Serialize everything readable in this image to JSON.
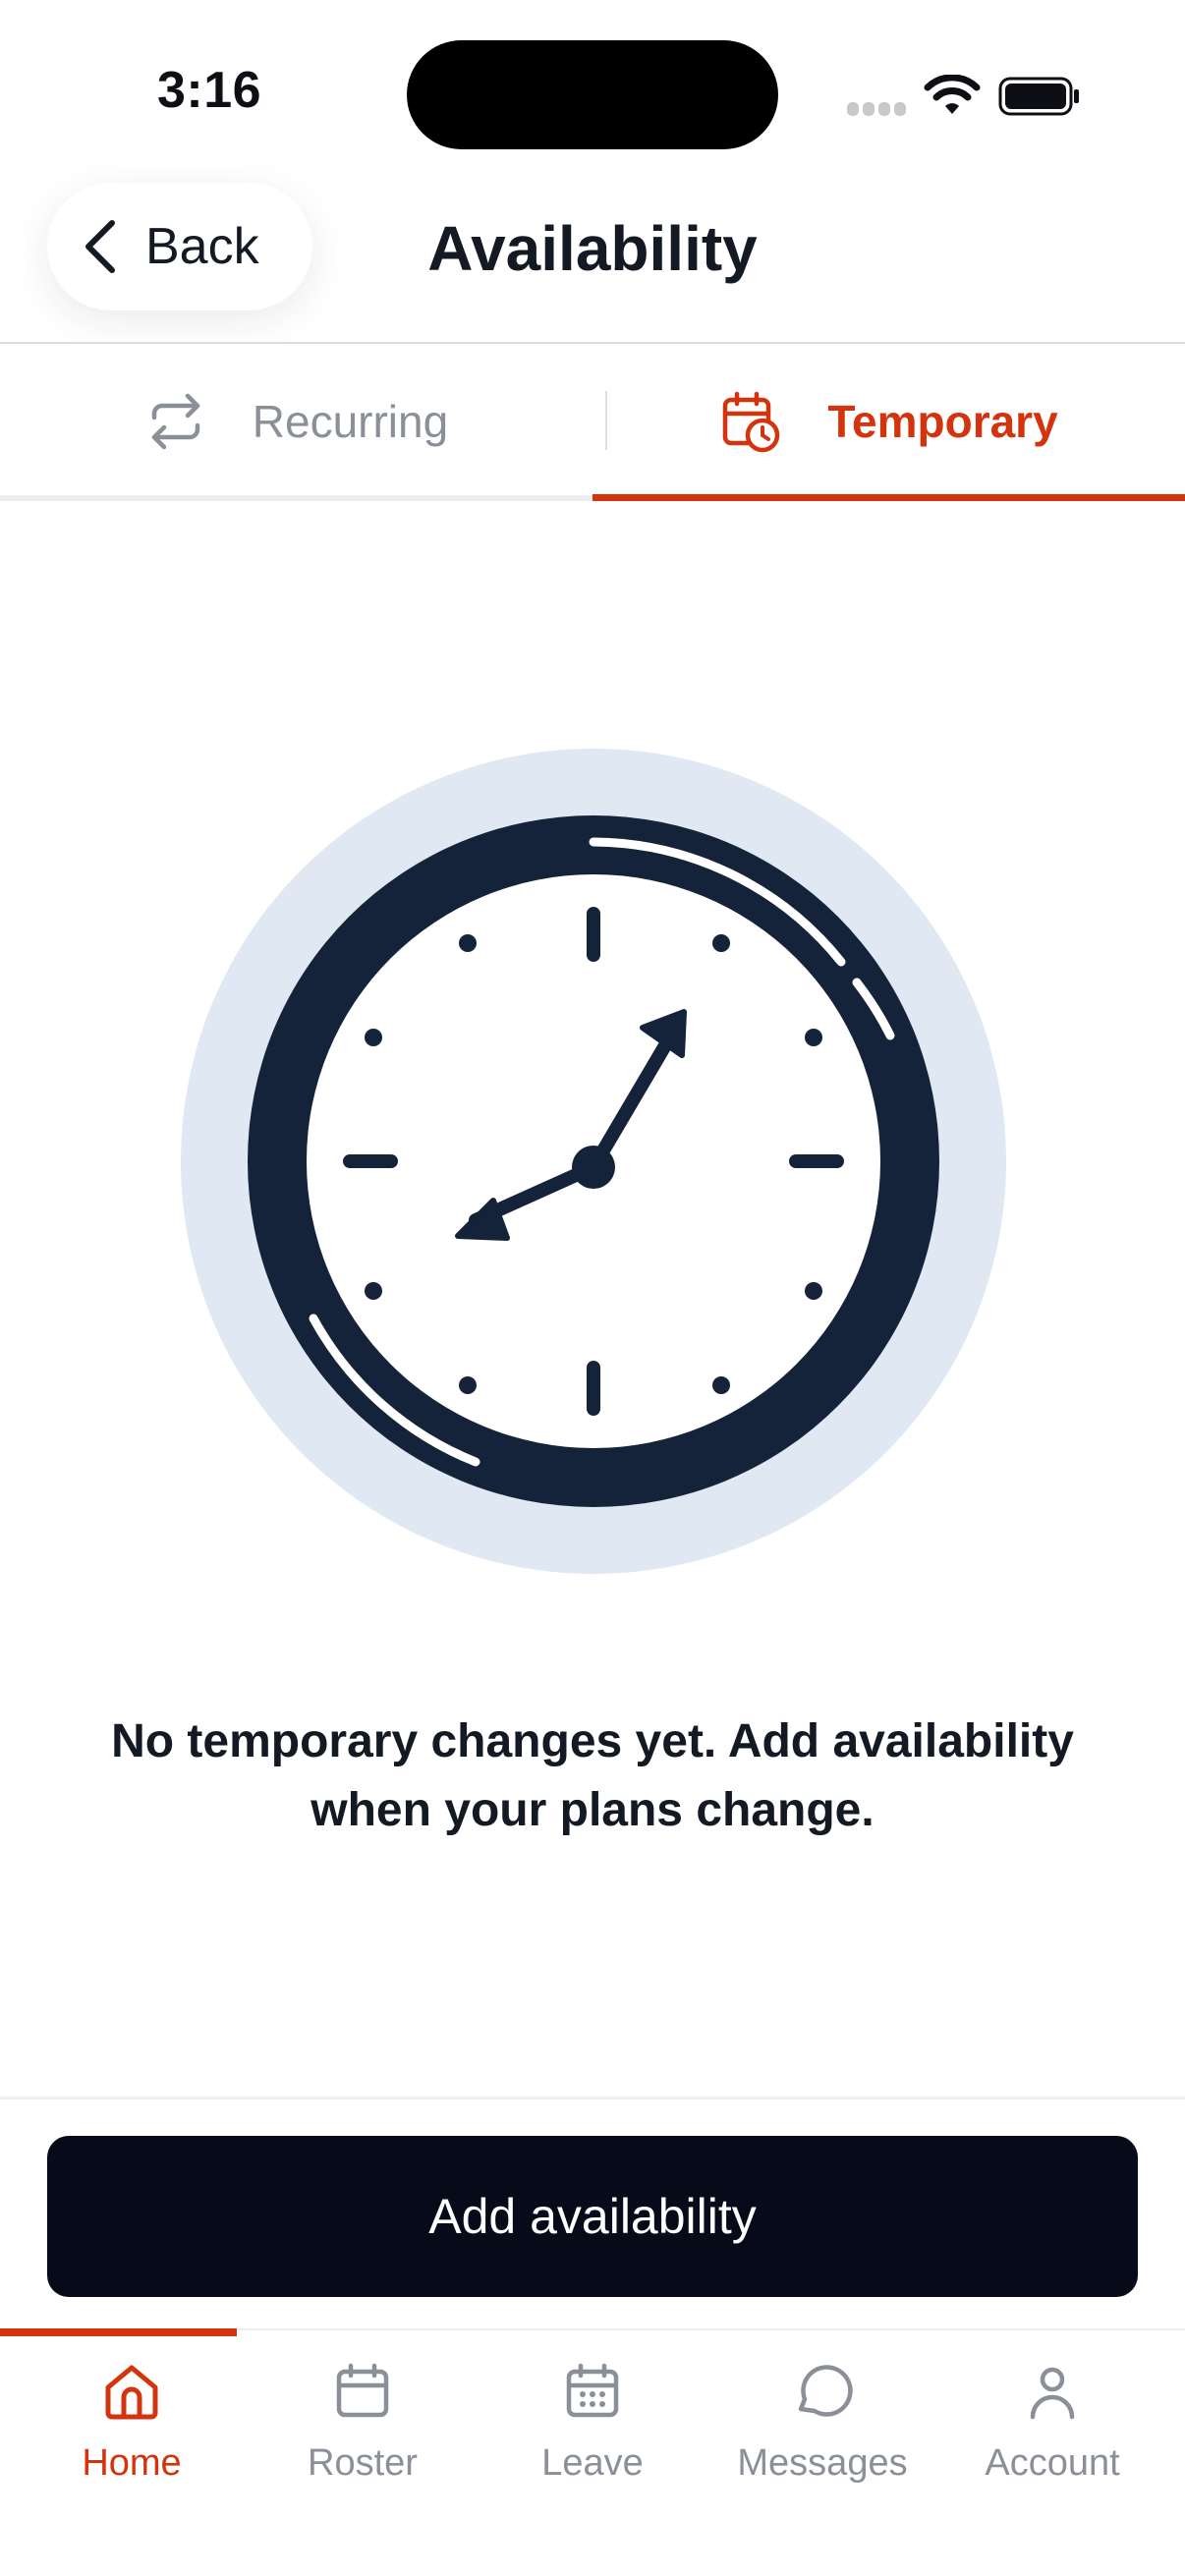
{
  "status_bar": {
    "time": "3:16"
  },
  "header": {
    "back_label": "Back",
    "title": "Availability"
  },
  "tabs": [
    {
      "label": "Recurring",
      "icon": "repeat-icon",
      "active": false
    },
    {
      "label": "Temporary",
      "icon": "calendar-clock-icon",
      "active": true
    }
  ],
  "empty_state": {
    "illustration": "clock-icon",
    "message": "No temporary changes yet. Add availability when your plans change."
  },
  "actions": {
    "add_label": "Add availability"
  },
  "tab_bar": {
    "items": [
      {
        "label": "Home",
        "icon": "home-icon",
        "active": true
      },
      {
        "label": "Roster",
        "icon": "calendar-icon",
        "active": false
      },
      {
        "label": "Leave",
        "icon": "calendar-grid-icon",
        "active": false
      },
      {
        "label": "Messages",
        "icon": "chat-bubble-icon",
        "active": false
      },
      {
        "label": "Account",
        "icon": "person-icon",
        "active": false
      }
    ]
  },
  "colors": {
    "accent": "#d4340d",
    "primary_dark": "#070b19",
    "muted": "#8a8f98",
    "clock_bg": "#e0e8f3",
    "clock_dark": "#15233a"
  }
}
